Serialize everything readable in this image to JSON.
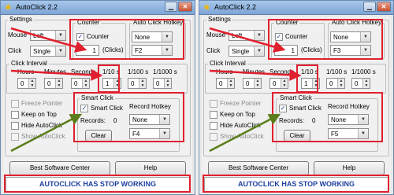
{
  "windows": [
    {
      "title": "AutoClick 2.2",
      "settings_label": "Settings",
      "mouse_label": "Mouse",
      "mouse_value": "Left",
      "click_label": "Click",
      "click_value": "Single",
      "counter_group": "Counter",
      "counter_check": "Counter",
      "counter_value": "1",
      "clicks_suffix": "(Clicks)",
      "hotkey_group": "Auto Click Hotkey",
      "hotkey_mod": "None",
      "hotkey_key": "F2",
      "interval_label": "Click Interval",
      "hours_label": "Hours",
      "minutes_label": "Minutes",
      "seconds_label": "Seconds",
      "s10_label": "1/10 s",
      "s100_label": "1/100 s",
      "s1000_label": "1/1000 s",
      "hours_value": "0",
      "minutes_value": "0",
      "seconds_value": "0",
      "s10_value": "1",
      "s100_value": "0",
      "s1000_value": "0",
      "freeze_label": "Freeze Pointer",
      "keepontop_label": "Keep on Top",
      "hide_label": "Hide AutoClick",
      "show_label": "Show AutoClick",
      "smart_group": "Smart Click",
      "smart_check": "Smart Click",
      "records_label": "Records:",
      "records_value": "0",
      "record_hotkey_label": "Record Hotkey",
      "record_mod": "None",
      "record_key": "F4",
      "clear_label": "Clear",
      "best_label": "Best Software Center",
      "help_label": "Help",
      "status": "AUTOCLICK HAS STOP WORKING"
    },
    {
      "title": "AutoClick 2.2",
      "settings_label": "Settings",
      "mouse_label": "Mouse",
      "mouse_value": "Left",
      "click_label": "Click",
      "click_value": "Single",
      "counter_group": "Counter",
      "counter_check": "Counter",
      "counter_value": "1",
      "clicks_suffix": "(Clicks)",
      "hotkey_group": "Auto Click Hotkey",
      "hotkey_mod": "None",
      "hotkey_key": "F3",
      "interval_label": "Click Interval",
      "hours_label": "Hours",
      "minutes_label": "Minutes",
      "seconds_label": "Seconds",
      "s10_label": "1/10 s",
      "s100_label": "1/100 s",
      "s1000_label": "1/1000 s",
      "hours_value": "0",
      "minutes_value": "0",
      "seconds_value": "0",
      "s10_value": "1",
      "s100_value": "0",
      "s1000_value": "0",
      "freeze_label": "Freeze Pointer",
      "keepontop_label": "Keep on Top",
      "hide_label": "Hide AutoClick",
      "show_label": "Show AutoClick",
      "smart_group": "Smart Click",
      "smart_check": "Smart Click",
      "records_label": "Records:",
      "records_value": "0",
      "record_hotkey_label": "Record Hotkey",
      "record_mod": "None",
      "record_key": "F5",
      "clear_label": "Clear",
      "best_label": "Best Software Center",
      "help_label": "Help",
      "status": "AUTOCLICK HAS STOP WORKING"
    }
  ],
  "colors": {
    "highlight": "#e0202e",
    "highlight_alt": "#5a7d1a",
    "status_text": "#1d3fa0",
    "titlebar": "#7da5d6"
  },
  "icons": {
    "app": "star-icon",
    "minimize": "minimize-icon",
    "close": "close-icon",
    "check": "check-icon",
    "dropdown": "chevron-down-icon",
    "spinner": "spin-arrows-icon"
  }
}
